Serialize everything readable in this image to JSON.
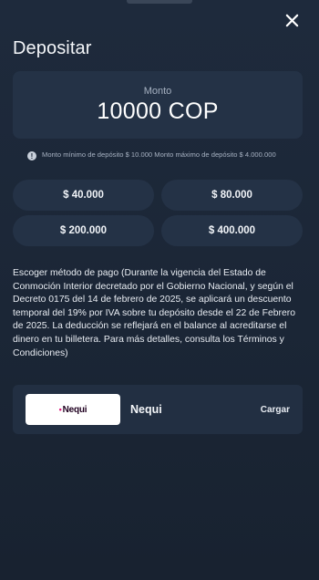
{
  "header": {
    "title": "Depositar"
  },
  "amount": {
    "label": "Monto",
    "value": "10000 COP"
  },
  "limits": {
    "icon": "info-icon",
    "text": "Monto mínimo de depósito $ 10.000 Monto máximo de depósito $ 4.000.000"
  },
  "presets": [
    {
      "label": "$ 40.000"
    },
    {
      "label": "$ 80.000"
    },
    {
      "label": "$ 200.000"
    },
    {
      "label": "$ 400.000"
    }
  ],
  "method_prompt": "Escoger método de pago (Durante la vigencia del Estado de Conmoción Interior decretado por el Gobierno Nacional, y según el Decreto 0175 del 14 de febrero de 2025, se aplicará un descuento temporal del 19% por IVA sobre tu depósito desde el 22 de Febrero de 2025. La deducción se reflejará en el balance al acreditarse el dinero en tu billetera. Para más detalles, consulta los Términos y Condiciones)",
  "payment_method": {
    "logo_text": "Nequi",
    "name": "Nequi",
    "action": "Cargar"
  },
  "colors": {
    "background": "#1b2637",
    "card": "#243246",
    "text_primary": "#ffffff",
    "text_muted": "#a6b1c1",
    "nequi_accent": "#e0177d"
  }
}
